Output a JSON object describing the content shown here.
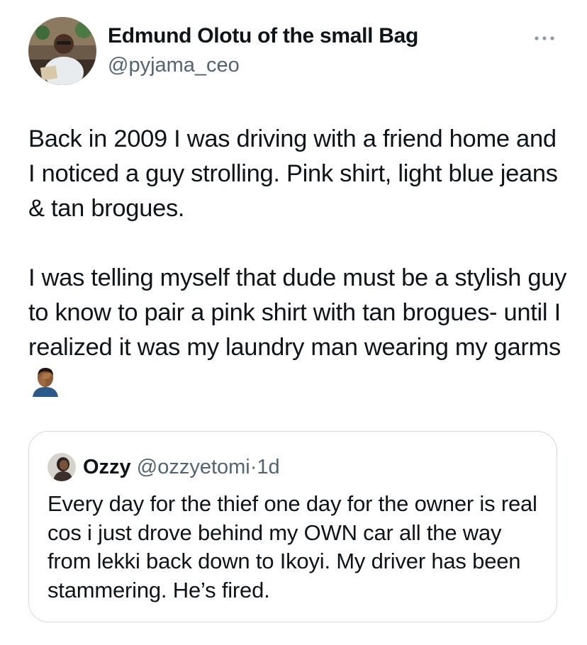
{
  "author": {
    "display_name": "Edmund Olotu of the small Bag",
    "handle": "@pyjama_ceo"
  },
  "tweet": {
    "text": "Back in 2009 I was driving with a friend home and I noticed a guy strolling. Pink shirt, light blue jeans & tan brogues.\n\nI was telling myself that dude must be a stylish guy to know to pair a pink shirt with tan brogues- until I realized it was my laundry man wearing my garms",
    "emoji_icon": "man-facepalming-emoji-icon"
  },
  "quoted_tweet": {
    "display_name": "Ozzy",
    "handle": "@ozzyetomi",
    "separator": "·",
    "time": "1d",
    "text": "Every day for the thief one day for the owner is real cos i just drove behind my OWN car all the way from lekki back down to Ikoyi. My driver has been stammering. He’s fired."
  },
  "icons": {
    "more": "more-options-icon",
    "avatar": "profile-avatar",
    "quote_avatar": "quoted-profile-avatar"
  },
  "colors": {
    "text_primary": "#0f1419",
    "text_secondary": "#536471",
    "border": "#cfd9de",
    "background": "#ffffff"
  }
}
